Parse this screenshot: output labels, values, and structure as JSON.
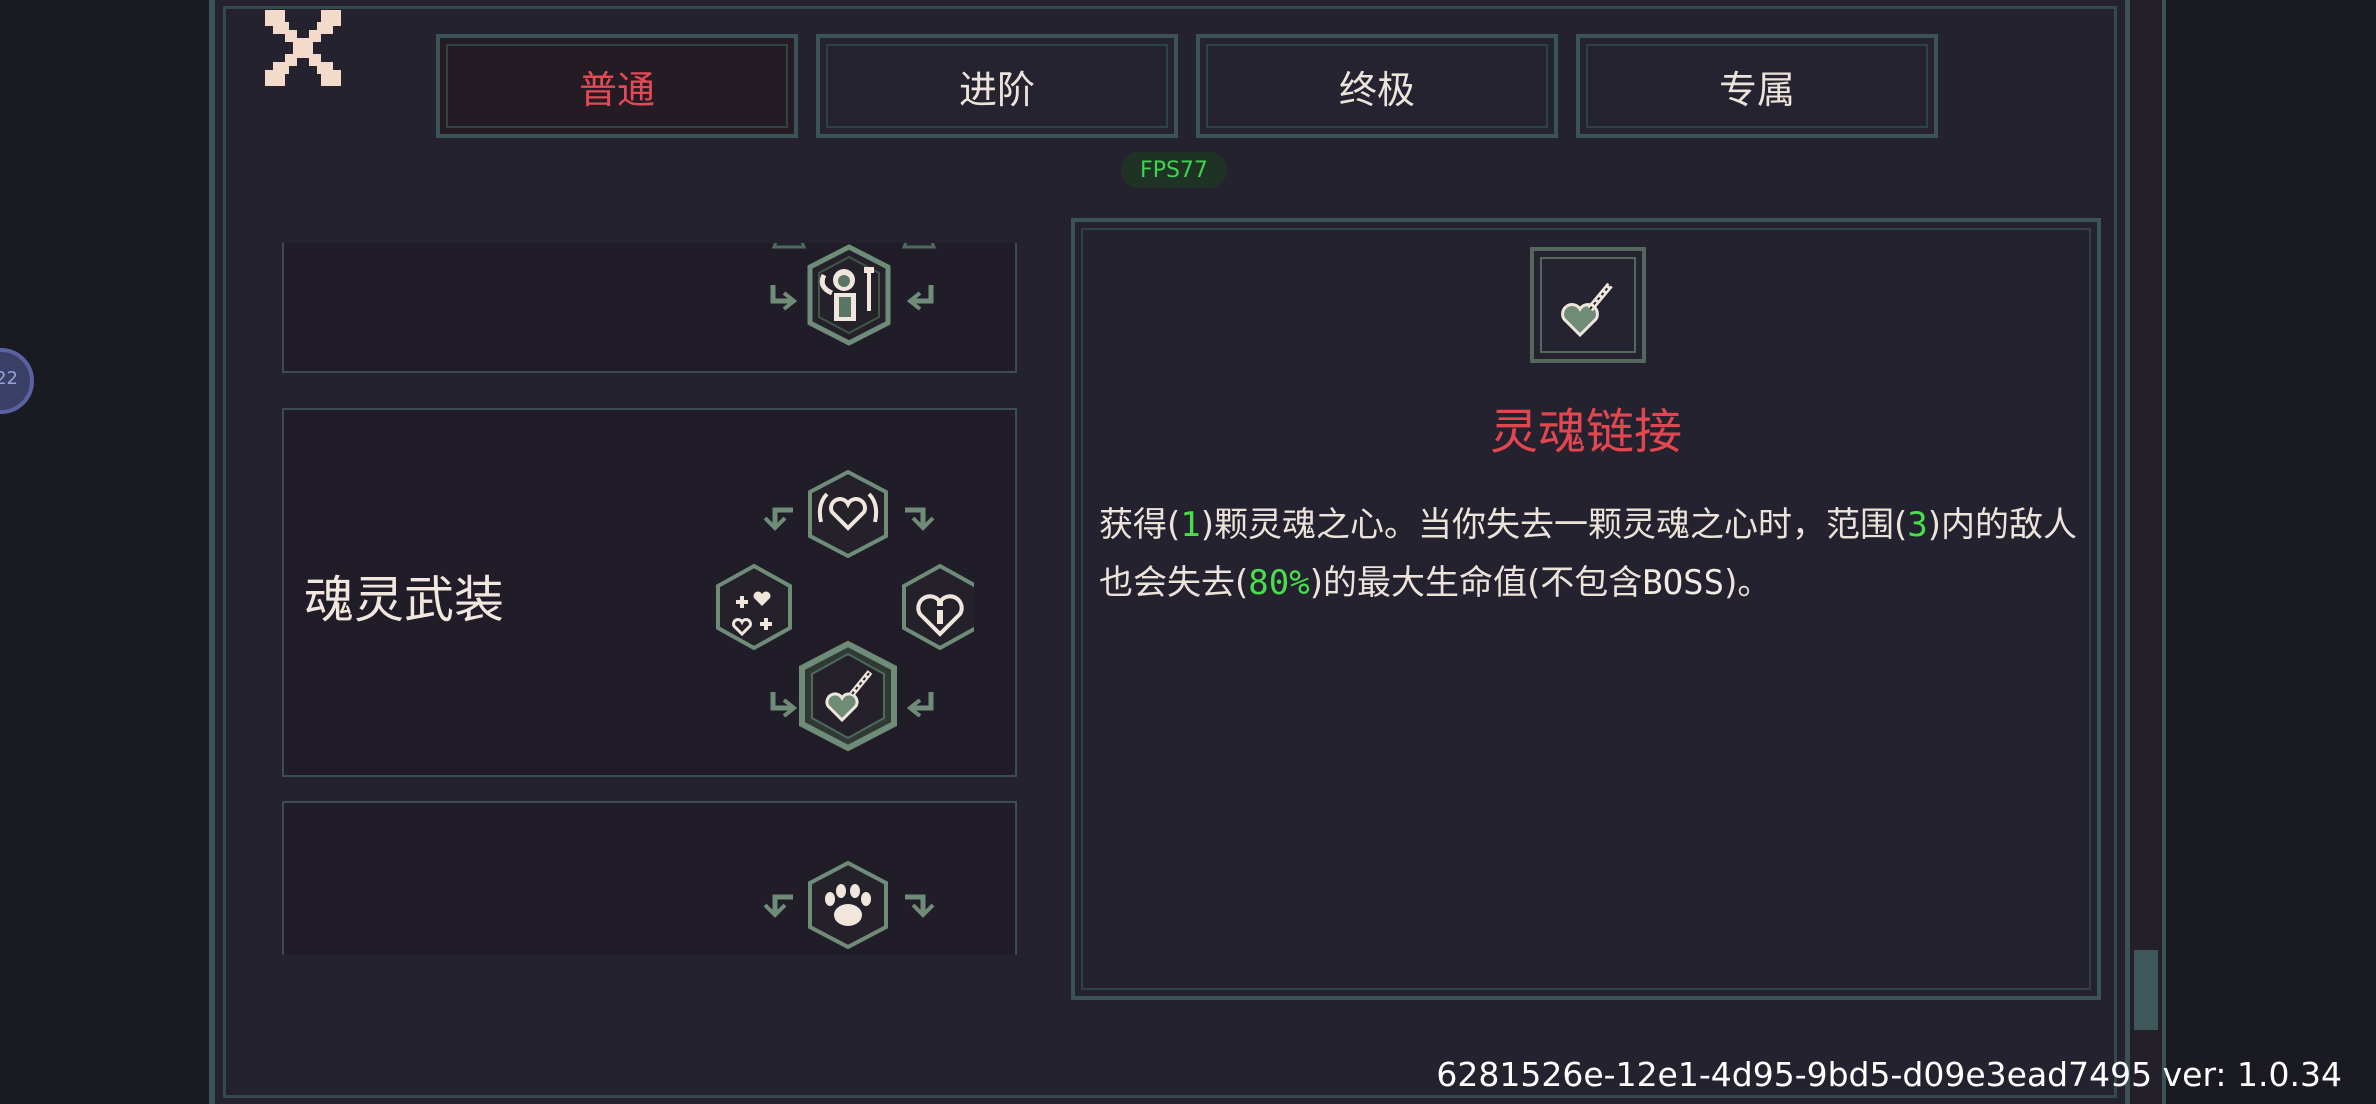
{
  "tabs": [
    {
      "label": "普通",
      "active": true
    },
    {
      "label": "进阶",
      "active": false
    },
    {
      "label": "终极",
      "active": false
    },
    {
      "label": "专属",
      "active": false
    }
  ],
  "fps_badge": "FPS77",
  "list": {
    "items": [
      {
        "title": "",
        "icon": "ghost-figure-icon"
      },
      {
        "title": "魂灵武装",
        "icon": "heart-chain-icon"
      },
      {
        "title": "",
        "icon": "paw-icon"
      }
    ]
  },
  "detail": {
    "icon": "heart-chain-icon",
    "title": "灵魂链接",
    "desc_parts": {
      "p1": "获得(",
      "n1": "1",
      "p2": ")颗灵魂之心。当你失去一颗灵魂之心时，范围(",
      "n2": "3",
      "p3": ")内的敌人也会失去(",
      "n3": "80%",
      "p4": ")的最大生命值(不包含",
      "boss": "BOSS",
      "p5": ")。"
    }
  },
  "footer": {
    "build_id": "6281526e-12e1-4d95-9bd5-d09e3ead7495",
    "version": "ver: 1.0.34"
  },
  "side_indicator": "22",
  "colors": {
    "accent_red": "#e24a55",
    "highlight_green": "#47e04b",
    "frame": "#3b5356",
    "icon_green": "#6f8c78"
  }
}
